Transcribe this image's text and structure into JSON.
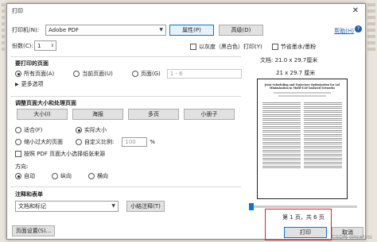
{
  "dialog": {
    "title": "打印",
    "printer_label": "打印机(N):",
    "printer_value": "Adobe PDF",
    "properties_btn": "属性(P)",
    "advanced_btn": "高级(D)",
    "help_link": "帮助(H)",
    "copies_label": "份数(C):",
    "copies_value": "1",
    "grayscale_label": "以灰度（黑白色）打印(Y)",
    "save_ink_label": "节省墨水/墨粉"
  },
  "pages": {
    "title": "要打印的页面",
    "all": "所有页面(A)",
    "current": "当前页面(U)",
    "page": "页面(G)",
    "range": "1 - 6",
    "more": "更多选项"
  },
  "sizing": {
    "title": "调整页面大小和处理页面",
    "size_btn": "大小(I)",
    "poster_btn": "海报",
    "multi_btn": "多页",
    "booklet_btn": "小册子",
    "fit": "适合(F)",
    "actual": "实际大小",
    "shrink": "缩小过大的页面",
    "custom": "自定义比例:",
    "scale_value": "100",
    "percent": "%",
    "paper_source": "按照 PDF 页面大小选择纸张来源"
  },
  "orientation": {
    "title": "方向:",
    "auto": "自动",
    "portrait": "纵向",
    "landscape": "横向"
  },
  "comments": {
    "title": "注释和表单",
    "value": "文档和标记",
    "summary_btn": "小结注释(T)"
  },
  "preview": {
    "doc_size": "文档: 21.0 x 29.7厘米",
    "paper_size": "21 x 29.7 厘米",
    "page_title": "Joint Scheduling and Trajectory Optimization for Aol Minimization in Multi-UAV-Assisted Networks",
    "page_info": "第 1 页，共 6 页"
  },
  "footer": {
    "page_setup_btn": "页面设置(S)...",
    "print_btn": "打印",
    "cancel_btn": "取消",
    "watermark": "CSDN @Icelysi"
  },
  "colors": {
    "accent": "#0078d7",
    "highlight_box": "#e02020",
    "link": "#1a5fb4"
  }
}
